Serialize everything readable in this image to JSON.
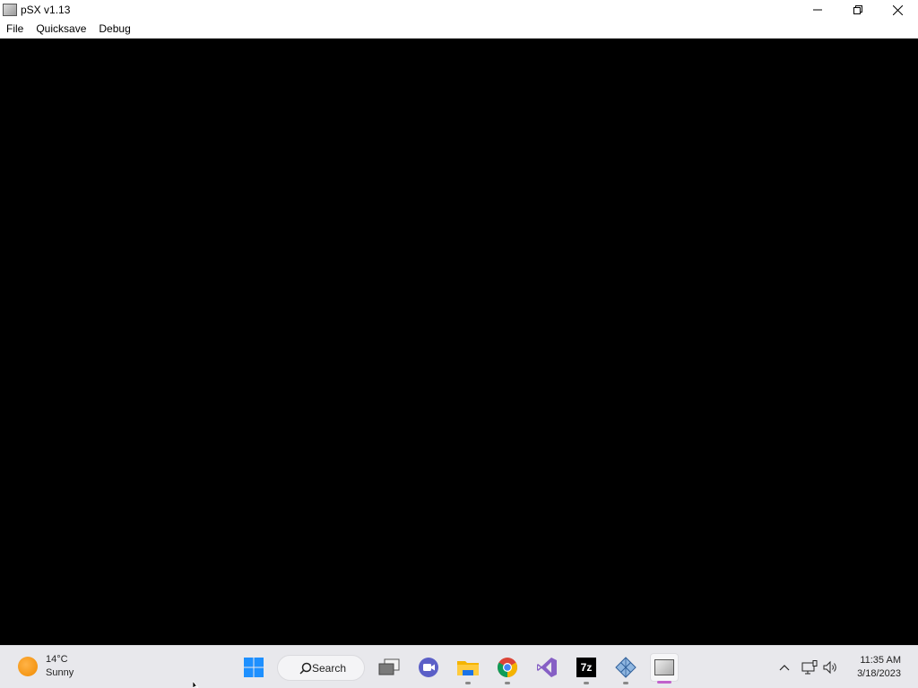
{
  "window": {
    "title": "pSX v1.13",
    "icon": "app-window-icon"
  },
  "menu": {
    "items": [
      "File",
      "Quicksave",
      "Debug"
    ]
  },
  "taskbar": {
    "weather": {
      "temp": "14°C",
      "condition": "Sunny"
    },
    "search_label": "Search",
    "apps": [
      {
        "name": "start-button",
        "icon": "windows-logo-icon"
      },
      {
        "name": "task-view",
        "icon": "task-view-icon"
      },
      {
        "name": "teams",
        "icon": "teams-video-icon"
      },
      {
        "name": "file-explorer",
        "icon": "folder-icon",
        "running": true
      },
      {
        "name": "chrome",
        "icon": "chrome-icon",
        "running": true
      },
      {
        "name": "visual-studio",
        "icon": "visual-studio-icon"
      },
      {
        "name": "7zip",
        "icon": "7zip-icon",
        "running": true,
        "label": "7z"
      },
      {
        "name": "network-tool",
        "icon": "network-diamond-icon",
        "running": true
      },
      {
        "name": "psx",
        "icon": "psx-icon",
        "running": true,
        "active": true
      }
    ],
    "clock": {
      "time": "11:35 AM",
      "date": "3/18/2023"
    }
  },
  "colors": {
    "accent": "#0078d4",
    "active_indicator": "#c061cb",
    "content_bg": "#000000"
  }
}
